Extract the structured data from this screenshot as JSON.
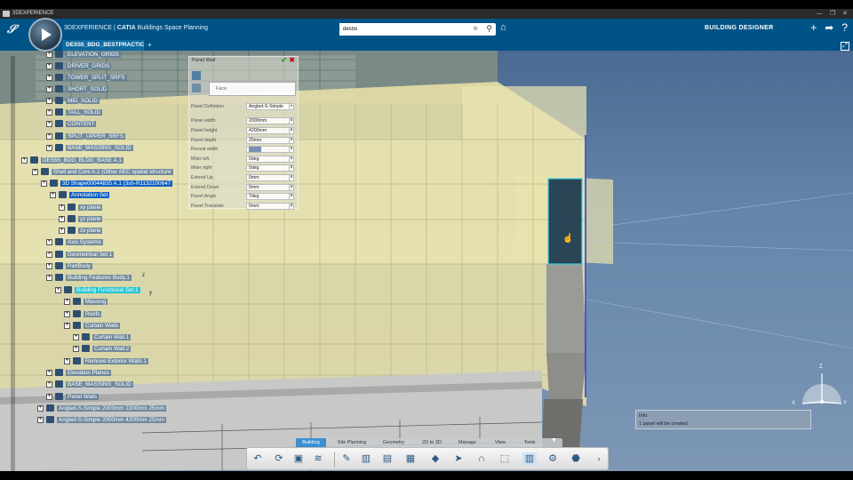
{
  "titlebar": {
    "title": "3DEXPERIENCE",
    "controls": [
      "—",
      "❐",
      "✕"
    ]
  },
  "header": {
    "brand": "3DEXPERIENCE",
    "product": "CATIA",
    "app": "Buildings Space Planning",
    "search_value": "des55",
    "search_clear": "⊗",
    "role": "BUILDING DESIGNER",
    "icons": [
      "+",
      "➦",
      "?"
    ]
  },
  "tab": {
    "label": "DES55_BDG_BESTPRACTIC",
    "add": "+"
  },
  "tree": {
    "items": [
      {
        "label": "ELEVATION_GRIDS",
        "sel": false
      },
      {
        "label": "DRIVER_GRIDS",
        "sel": false
      },
      {
        "label": "TOWER_SPLIT_SRFS",
        "sel": false
      },
      {
        "label": "SHORT_SOLID",
        "sel": false
      },
      {
        "label": "MID_SOLID",
        "sel": false
      },
      {
        "label": "TALL_SOLID",
        "sel": false
      },
      {
        "label": "CONTENT",
        "sel": false
      },
      {
        "label": "SPLIT_UPPER_SRFS",
        "sel": false
      },
      {
        "label": "BASE_MASSING_SOLID",
        "sel": false
      },
      {
        "label": "DES55_BDG_BLDG_BASE A.1",
        "sel": false
      },
      {
        "label": "Shell and Core A.1 (Other AEC spatial structure",
        "sel": false
      },
      {
        "label": "3D Shape00044835 A.1 (3sh-R1132100647",
        "sel": true
      },
      {
        "label": "Annotation Set",
        "sel": true
      },
      {
        "label": "xy plane",
        "sel": false
      },
      {
        "label": "yz plane",
        "sel": false
      },
      {
        "label": "zx plane",
        "sel": false
      },
      {
        "label": "Axis Systems",
        "sel": false
      },
      {
        "label": "Geometrical Set.1",
        "sel": false
      },
      {
        "label": "PartBody",
        "sel": false
      },
      {
        "label": "Building Features Body.1",
        "sel": false
      },
      {
        "label": "Building Functional Set.1",
        "sel": false,
        "cyan": true
      },
      {
        "label": "Massing",
        "sel": false
      },
      {
        "label": "Roofs",
        "sel": false
      },
      {
        "label": "Curtain Walls",
        "sel": false
      },
      {
        "label": "Curtain Wall.1",
        "sel": false
      },
      {
        "label": "Curtain Wall.2",
        "sel": false
      },
      {
        "label": "Remove Exterior Walls.1",
        "sel": false
      },
      {
        "label": "Elevation Planes",
        "sel": false
      },
      {
        "label": "BASE_MASSING_SOLID",
        "sel": false
      },
      {
        "label": "Panel Walls",
        "sel": false
      },
      {
        "label": "Angled-S-Simple 2000mm 2200mm 25mm",
        "sel": false
      },
      {
        "label": "Angled-S-Simple 2000mm 4200mm 25mm",
        "sel": false
      }
    ]
  },
  "dialog": {
    "title": "Panel Wall",
    "ok": "✔",
    "cancel": "✖",
    "face_label": "Face",
    "rows": [
      {
        "label": "Panel Definition",
        "value": "Angled-S-Simple"
      },
      {
        "label": "Panel width",
        "value": "2000mm"
      },
      {
        "label": "Panel height",
        "value": "4200mm"
      },
      {
        "label": "Panel depth",
        "value": "25mm"
      },
      {
        "label": "Reveal width",
        "value": "25mm"
      },
      {
        "label": "Miter left",
        "value": "0deg"
      },
      {
        "label": "Miter right",
        "value": "0deg"
      },
      {
        "label": "Extend Up",
        "value": "0mm"
      },
      {
        "label": "Extend Down",
        "value": "0mm"
      },
      {
        "label": "Panel Angle",
        "value": "7deg"
      },
      {
        "label": "Panel Translate",
        "value": "0mm"
      }
    ]
  },
  "info": {
    "title": "Info:",
    "message": "1 panel will be created."
  },
  "triad": {
    "z": "Z",
    "x": "X",
    "y": "Y"
  },
  "scene_axes": {
    "z": "z",
    "y": "y"
  },
  "action_tabs": [
    "Building",
    "Site Planning",
    "Geometry",
    "2D to 3D",
    "Manage",
    "View",
    "Tools"
  ],
  "active_tab": "Building",
  "colors": {
    "brand_blue": "#005386",
    "glass": "#f0e8b0",
    "selected_panel": "#1f3d52",
    "selection": "#1060c0"
  }
}
